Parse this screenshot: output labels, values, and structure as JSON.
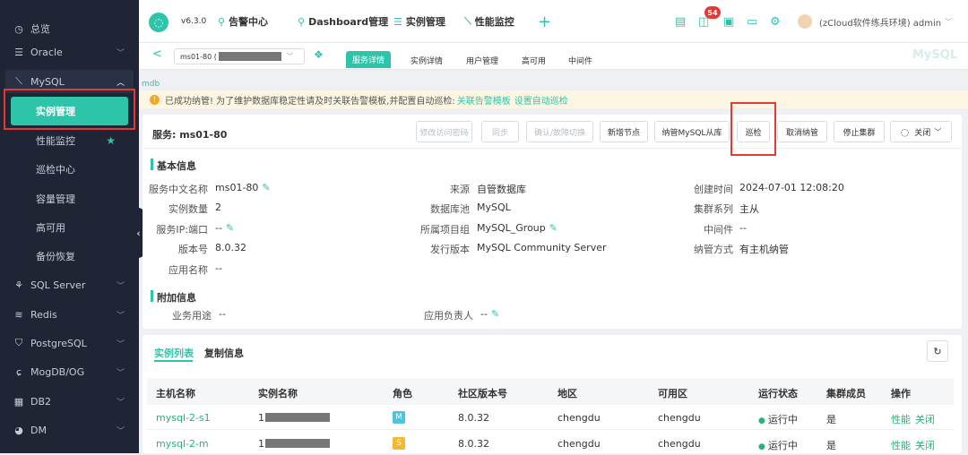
{
  "sidebar": {
    "items": [
      {
        "label": "总览",
        "icon": "clock-icon"
      },
      {
        "label": "Oracle",
        "icon": "database-icon"
      },
      {
        "label": "MySQL",
        "icon": "mysql-icon"
      },
      {
        "label": "SQL Server",
        "icon": "sqlserver-icon"
      },
      {
        "label": "Redis",
        "icon": "redis-icon"
      },
      {
        "label": "PostgreSQL",
        "icon": "postgresql-icon"
      },
      {
        "label": "MogDB/OG",
        "icon": "mogdb-icon"
      },
      {
        "label": "DB2",
        "icon": "db2-icon"
      },
      {
        "label": "DM",
        "icon": "dm-icon"
      }
    ],
    "mysql_sub": [
      "实例管理",
      "性能监控",
      "巡检中心",
      "容量管理",
      "高可用",
      "备份恢复"
    ]
  },
  "topbar": {
    "version": "v6.3.0",
    "nav": [
      "告警中心",
      "Dashboard管理",
      "实例管理",
      "性能监控"
    ],
    "plus": "+",
    "badge": "54",
    "user": "(zCloud软件练兵环境) admin"
  },
  "tabs": {
    "back": "<",
    "selector": "ms01-80 (",
    "items": [
      "服务详情",
      "实例详情",
      "用户管理",
      "高可用",
      "中间件"
    ],
    "brand": "MySQL"
  },
  "breadcrumb": "mdb",
  "notice": {
    "text": "已成功纳管! 为了维护数据库稳定性请及时关联告警模板,并配置自动巡检:",
    "link1": "关联告警模板",
    "link2": "设置自动巡检"
  },
  "service": {
    "title": "服务: ms01-80",
    "buttons": [
      "修改访问密码",
      "同步",
      "确认/故障切换",
      "新增节点",
      "纳管MySQL从库",
      "巡检",
      "取消纳管",
      "停止集群",
      "关闭"
    ]
  },
  "basic": {
    "heading": "基本信息",
    "rows": [
      [
        "服务中文名称",
        "ms01-80",
        "来源",
        "自管数据库",
        "创建时间",
        "2024-07-01 12:08:20"
      ],
      [
        "实例数量",
        "2",
        "数据库池",
        "MySQL",
        "集群系列",
        "主从"
      ],
      [
        "服务IP:端口",
        "--",
        "所属项目组",
        "MySQL_Group",
        "中间件",
        "--"
      ],
      [
        "版本号",
        "8.0.32",
        "发行版本",
        "MySQL Community Server",
        "纳管方式",
        "有主机纳管"
      ],
      [
        "应用名称",
        "--",
        "",
        "",
        "",
        ""
      ]
    ]
  },
  "extra": {
    "heading": "附加信息",
    "biz_label": "业务用途",
    "biz_val": "--",
    "owner_label": "应用负责人",
    "owner_val": "--"
  },
  "list": {
    "tabs": [
      "实例列表",
      "复制信息"
    ],
    "headers": [
      "主机名称",
      "实例名称",
      "角色",
      "社区版本号",
      "地区",
      "可用区",
      "运行状态",
      "集群成员",
      "操作"
    ],
    "rows": [
      {
        "host": "mysql-2-s1",
        "inst": "1",
        "role": "M",
        "ver": "8.0.32",
        "region": "chengdu",
        "zone": "chengdu",
        "status": "运行中",
        "member": "是",
        "ops": [
          "性能",
          "关闭"
        ]
      },
      {
        "host": "mysql-2-m",
        "inst": "1",
        "role": "S",
        "ver": "8.0.32",
        "region": "chengdu",
        "zone": "chengdu",
        "status": "运行中",
        "member": "是",
        "ops": [
          "性能",
          "关闭"
        ]
      }
    ]
  },
  "colors": {
    "accent": "#2ec4a9",
    "sidebar": "#1f2535",
    "highlight": "#e53935",
    "role_m": "#4fc3d9",
    "role_s": "#f5b82e"
  }
}
